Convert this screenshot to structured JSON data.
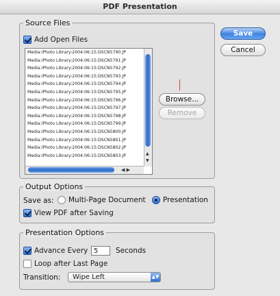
{
  "window": {
    "title": "PDF Presentation"
  },
  "source_files": {
    "group_label": "Source Files",
    "add_open_files": {
      "label": "Add Open Files",
      "checked": true
    },
    "files": [
      "Media:iPhoto Library:2004:06:15:DSCN5790.JP",
      "Media:iPhoto Library:2004:06:15:DSCN5791.JP",
      "Media:iPhoto Library:2004:06:15:DSCN5792.JP",
      "Media:iPhoto Library:2004:06:15:DSCN5793.JP",
      "Media:iPhoto Library:2004:06:15:DSCN5794.JP",
      "Media:iPhoto Library:2004:06:15:DSCN5795.JP",
      "Media:iPhoto Library:2004:06:15:DSCN5796.JP",
      "Media:iPhoto Library:2004:06:15:DSCN5797.JP",
      "Media:iPhoto Library:2004:06:15:DSCN5798.JP",
      "Media:iPhoto Library:2004:06:15:DSCN5799.JP",
      "Media:iPhoto Library:2004:06:15:DSCN5800.JP",
      "Media:iPhoto Library:2004:06:15:DSCN5801.JP",
      "Media:iPhoto Library:2004:06:15:DSCN5802.JP",
      "Media:iPhoto Library:2004:06:15:DSCN5803.JP"
    ],
    "browse_button": "Browse...",
    "remove_button": "Remove"
  },
  "buttons": {
    "save": "Save",
    "cancel": "Cancel"
  },
  "output_options": {
    "group_label": "Output Options",
    "save_as_label": "Save as:",
    "options": [
      {
        "label": "Multi-Page Document",
        "selected": false
      },
      {
        "label": "Presentation",
        "selected": true
      }
    ],
    "view_pdf": {
      "label": "View PDF after Saving",
      "checked": true
    }
  },
  "presentation_options": {
    "group_label": "Presentation Options",
    "advance_every": {
      "label": "Advance Every",
      "checked": true,
      "value": "5",
      "unit": "Seconds"
    },
    "loop": {
      "label": "Loop after Last Page",
      "checked": false
    },
    "transition_label": "Transition:",
    "transition_value": "Wipe Left"
  },
  "colors": {
    "accent": "#3f82e0",
    "background": "#e8e8e8"
  }
}
